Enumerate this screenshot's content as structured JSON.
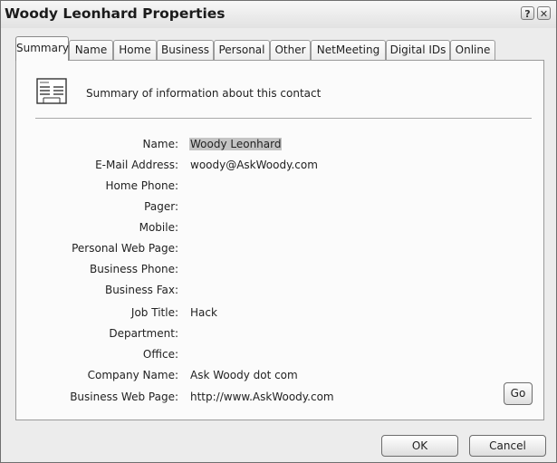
{
  "window": {
    "title": "Woody Leonhard Properties",
    "help_glyph": "?",
    "close_glyph": "✕"
  },
  "tabs": [
    {
      "label": "Summary",
      "active": true
    },
    {
      "label": "Name",
      "active": false
    },
    {
      "label": "Home",
      "active": false
    },
    {
      "label": "Business",
      "active": false
    },
    {
      "label": "Personal",
      "active": false
    },
    {
      "label": "Other",
      "active": false
    },
    {
      "label": "NetMeeting",
      "active": false
    },
    {
      "label": "Digital IDs",
      "active": false
    },
    {
      "label": "Online",
      "active": false
    }
  ],
  "summary": {
    "icon": "contact-card-icon",
    "description": "Summary of information about this contact"
  },
  "fields": [
    {
      "label": "Name:",
      "value": "Woody Leonhard"
    },
    {
      "label": "E-Mail Address:",
      "value": "woody@AskWoody.com"
    },
    {
      "label": "Home Phone:",
      "value": ""
    },
    {
      "label": "Pager:",
      "value": ""
    },
    {
      "label": "Mobile:",
      "value": ""
    },
    {
      "label": "Personal Web Page:",
      "value": ""
    },
    {
      "label": "Business Phone:",
      "value": ""
    },
    {
      "label": "Business Fax:",
      "value": ""
    },
    {
      "label": "Job Title:",
      "value": "Hack"
    },
    {
      "label": "Department:",
      "value": ""
    },
    {
      "label": "Office:",
      "value": ""
    },
    {
      "label": "Company Name:",
      "value": "Ask Woody dot com"
    },
    {
      "label": "Business Web Page:",
      "value": "http://www.AskWoody.com"
    }
  ],
  "buttons": {
    "go_label": "Go",
    "ok_label": "OK",
    "cancel_label": "Cancel"
  }
}
